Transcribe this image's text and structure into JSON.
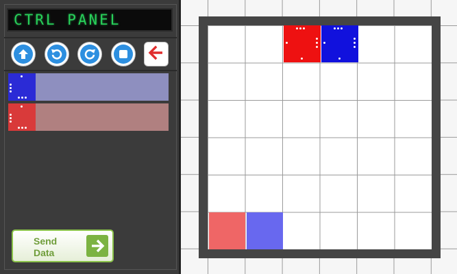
{
  "panel": {
    "title": "CTRL PANEL",
    "toolbar": [
      {
        "name": "forward-button",
        "icon": "arrow-up-icon"
      },
      {
        "name": "rotate-left-button",
        "icon": "rotate-ccw-icon"
      },
      {
        "name": "rotate-right-button",
        "icon": "rotate-cw-icon"
      },
      {
        "name": "stop-button",
        "icon": "stop-icon"
      },
      {
        "name": "back-button",
        "icon": "arrow-left-icon"
      }
    ],
    "commands": [
      {
        "player": "blue",
        "color": "#2b2bd6",
        "bar_color": "#8e8fbf"
      },
      {
        "player": "red",
        "color": "#d93a3a",
        "bar_color": "#b08080"
      }
    ],
    "send_button": {
      "label": "Send Data",
      "icon": "arrow-right-icon"
    }
  },
  "board": {
    "rows": 6,
    "cols": 6,
    "pieces": [
      {
        "name": "red-robot",
        "color": "#ee1111",
        "row": 0,
        "col": 2,
        "facing": "right"
      },
      {
        "name": "blue-robot",
        "color": "#1111dd",
        "row": 0,
        "col": 3,
        "facing": "right"
      }
    ],
    "targets": [
      {
        "name": "red-target",
        "color": "#ef6666",
        "row": 5,
        "col": 0
      },
      {
        "name": "blue-target",
        "color": "#6868ef",
        "row": 5,
        "col": 1
      }
    ]
  }
}
